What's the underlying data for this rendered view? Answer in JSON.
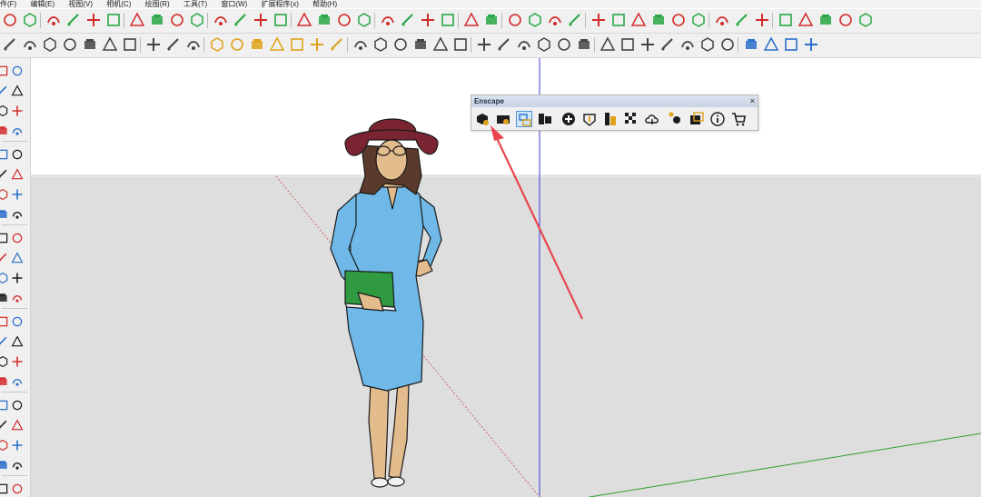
{
  "menu": [
    "件(F)",
    "编辑(E)",
    "视图(V)",
    "相机(C)",
    "绘图(R)",
    "工具(T)",
    "窗口(W)",
    "扩展程序(x)",
    "帮助(H)"
  ],
  "toolbar_row1": [
    "zoom-icon",
    "select-arrow-icon",
    "eraser-icon",
    "pencil-icon",
    "line-icon",
    "rectangle-icon",
    "push-pull-icon",
    "follow-me-icon",
    "move-icon",
    "rotate-icon",
    "scale-icon",
    "offset-icon",
    "paint-bucket-icon",
    "eyedropper-icon",
    "section-plane-icon",
    "section-display-icon",
    "search-icon",
    "zoom-extents-icon",
    "settings-icon",
    "layers-icon",
    "styles-icon",
    "user-icon",
    "new-file-icon",
    "account-icon",
    "open-folder-icon",
    "gear-icon",
    "close-circle-icon",
    "render-icon",
    "badge-50-icon",
    "badge-75-icon",
    "droplet-icon",
    "material-icon",
    "cloud-icon",
    "cloud-download-icon",
    "highlight-icon",
    "point-icon",
    "dotted-line-icon",
    "hex1-icon",
    "hex2-icon",
    "hex3-icon",
    "hex4-icon",
    "hex5-icon"
  ],
  "toolbar_row2": [
    "orbit-icon",
    "pan-icon",
    "walk-icon",
    "look-around-icon",
    "position-camera-icon",
    "previous-view-icon",
    "next-view-icon",
    "section-cut-icon",
    "display-icon",
    "lock-icon",
    "component-icon",
    "dimension-icon",
    "protractor-icon",
    "angle-icon",
    "text-icon",
    "axes-icon",
    "3d-text-icon",
    "iso-view-icon",
    "top-view-icon",
    "front-view-icon",
    "right-view-icon",
    "back-view-icon",
    "left-view-icon",
    "xray-icon",
    "wireframe-icon",
    "hidden-line-icon",
    "shaded-icon",
    "textured-icon",
    "monochrome-icon",
    "sandbox-icon",
    "grid-icon",
    "terrain-icon",
    "smoove-icon",
    "stamp-icon",
    "drape-icon",
    "flip-icon",
    "box-blue-icon",
    "box-outline-icon",
    "box-dark-icon",
    "box-teal-icon"
  ],
  "left_toolbar": [
    "select-icon",
    "paint-icon",
    "eraser-icon",
    "line-icon",
    "arc-icon",
    "rectangle-icon",
    "circle-icon",
    "polygon-icon",
    "push-pull-icon",
    "offset-icon",
    "move-icon",
    "rotate-icon",
    "scale-icon",
    "tape-icon",
    "dimension-icon",
    "text-icon",
    "axes-icon",
    "orbit-icon",
    "pan-icon",
    "zoom-icon",
    "walk-icon",
    "section-icon"
  ],
  "enscape": {
    "title": "Enscape",
    "close": "×",
    "buttons": [
      {
        "name": "start-enscape-icon",
        "active": false
      },
      {
        "name": "live-update-icon",
        "active": false
      },
      {
        "name": "sync-views-icon",
        "active": true
      },
      {
        "name": "capture-icon",
        "active": false
      },
      {
        "name": "add-icon",
        "active": false
      },
      {
        "name": "upload-icon",
        "active": false
      },
      {
        "name": "asset-library-icon",
        "active": false
      },
      {
        "name": "material-editor-icon",
        "active": false
      },
      {
        "name": "cloud-upload-icon",
        "active": false
      },
      {
        "name": "settings-icon",
        "active": false
      },
      {
        "name": "window-icon",
        "active": false
      },
      {
        "name": "info-icon",
        "active": false
      },
      {
        "name": "cart-icon",
        "active": false
      }
    ]
  },
  "colors": {
    "toolbar_bg": "#f0f0f0",
    "ground": "#dedede",
    "dress": "#6fb8e8",
    "hat": "#7a2432",
    "arrow": "#e8474e",
    "axis_blue": "#3b3bd4",
    "axis_green": "#2ea02e",
    "axis_red": "#c84c4c"
  }
}
